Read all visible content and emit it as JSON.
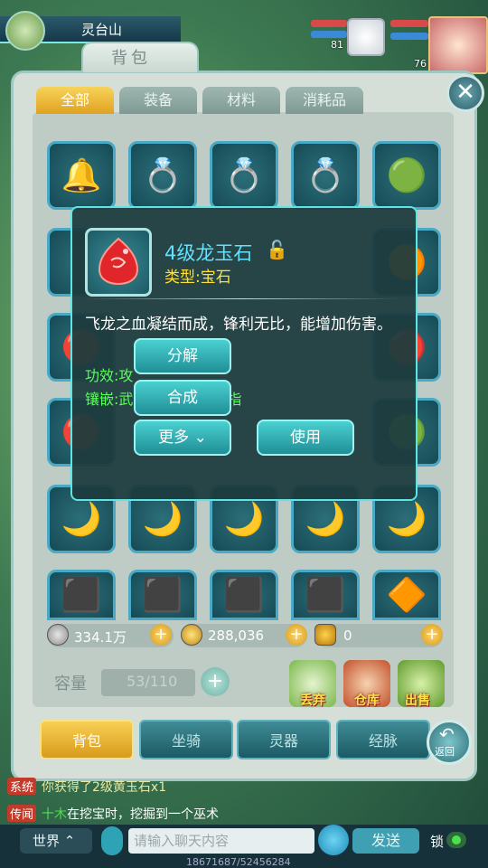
{
  "hud": {
    "location": "灵台山",
    "pet_level": "81",
    "hero_level": "76"
  },
  "panel": {
    "title": "背包",
    "close_label": "✕",
    "tabs": [
      "全部",
      "装备",
      "材料",
      "消耗品"
    ],
    "capacity_label": "容量",
    "capacity_value": "53/110"
  },
  "currency": {
    "silver": "334.1万",
    "gold_coins": "288,036",
    "ingot": "0"
  },
  "actions": {
    "discard": "丢弃",
    "warehouse": "仓库",
    "sell": "出售"
  },
  "bottom_tabs": [
    "背包",
    "坐骑",
    "灵器",
    "经脉"
  ],
  "back_label": "返回",
  "popup": {
    "name": "4级龙玉石",
    "type": "类型:宝石",
    "desc": "飞龙之血凝结而成，锋利无比，能增加伤害。",
    "effect": "功效:攻",
    "inlay": "镶嵌:武",
    "inlay_tail": "戒指",
    "buttons": {
      "decompose": "分解",
      "combine": "合成",
      "more": "更多",
      "use": "使用"
    }
  },
  "chat": {
    "system_tag": "系统",
    "system_msg": "你获得了2级黄玉石x1",
    "legend_tag": "传闻",
    "legend_msg_name": "十木",
    "legend_msg": "在挖宝时，挖掘到一个巫术",
    "channel": "世界",
    "placeholder": "请输入聊天内容",
    "send": "发送",
    "lock": "锁",
    "coords": "18671687/52456284"
  },
  "colors": {
    "accent_cyan": "#5fe3e3",
    "gold_tab": "#f7cf54",
    "green_text": "#5aff5a",
    "name_text": "#5fe3ff",
    "type_text": "#ffe03a"
  }
}
